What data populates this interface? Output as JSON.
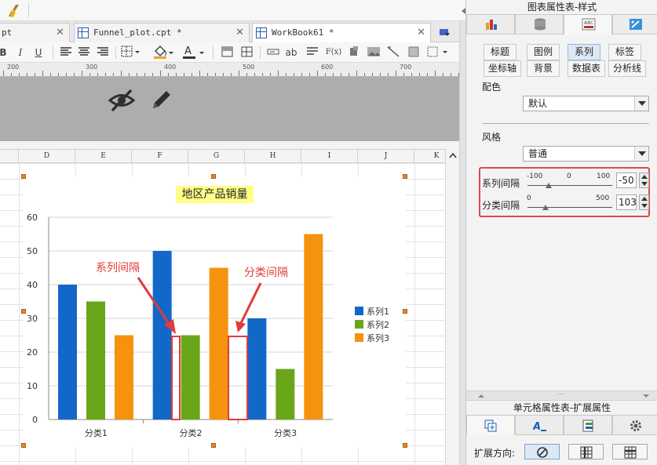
{
  "tabs": [
    {
      "label": "pt"
    },
    {
      "label": "Funnel_plot.cpt *"
    },
    {
      "label": "WorkBook61 *"
    }
  ],
  "format_toolbar": {
    "bold": "B",
    "italic": "I",
    "underline": "U",
    "text_ab": "ab",
    "formula": "F(x)"
  },
  "ruler": {
    "marks": [
      "200",
      "300",
      "400",
      "500",
      "600",
      "700"
    ]
  },
  "columns": [
    "D",
    "E",
    "F",
    "G",
    "H",
    "I",
    "J",
    "K"
  ],
  "chart_data": {
    "type": "bar",
    "title": "地区产品销量",
    "categories": [
      "分类1",
      "分类2",
      "分类3"
    ],
    "series": [
      {
        "name": "系列1",
        "color": "#1268c8",
        "values": [
          40,
          50,
          30
        ]
      },
      {
        "name": "系列2",
        "color": "#6aa619",
        "values": [
          35,
          25,
          15
        ]
      },
      {
        "name": "系列3",
        "color": "#f5920e",
        "values": [
          25,
          45,
          55
        ]
      }
    ],
    "ylim": [
      0,
      60
    ],
    "yticks": [
      "0",
      "10",
      "20",
      "30",
      "40",
      "50",
      "60"
    ],
    "grid": true,
    "legend_position": "right",
    "annotations": [
      {
        "text": "系列间隔",
        "color": "#e03c3c"
      },
      {
        "text": "分类间隔",
        "color": "#e03c3c"
      }
    ]
  },
  "right_panel": {
    "title": "图表属性表-样式",
    "subtabs_row1": [
      "标题",
      "图例",
      "系列",
      "标签"
    ],
    "subtabs_row2": [
      "坐标轴",
      "背景",
      "数据表",
      "分析线"
    ],
    "active_subtab": "系列",
    "color_label": "配色",
    "color_value": "默认",
    "style_label": "风格",
    "style_value": "普通",
    "series_gap": {
      "label": "系列间隔",
      "min": "-100",
      "mid": "0",
      "max": "100",
      "value": "-50",
      "level": 0.25
    },
    "category_gap": {
      "label": "分类间隔",
      "min": "0",
      "max": "500",
      "value": "103",
      "level": 0.21
    },
    "highlight_color": "#e04848",
    "cell_title": "单元格属性表-扩展属性",
    "expand_label": "扩展方向:"
  }
}
